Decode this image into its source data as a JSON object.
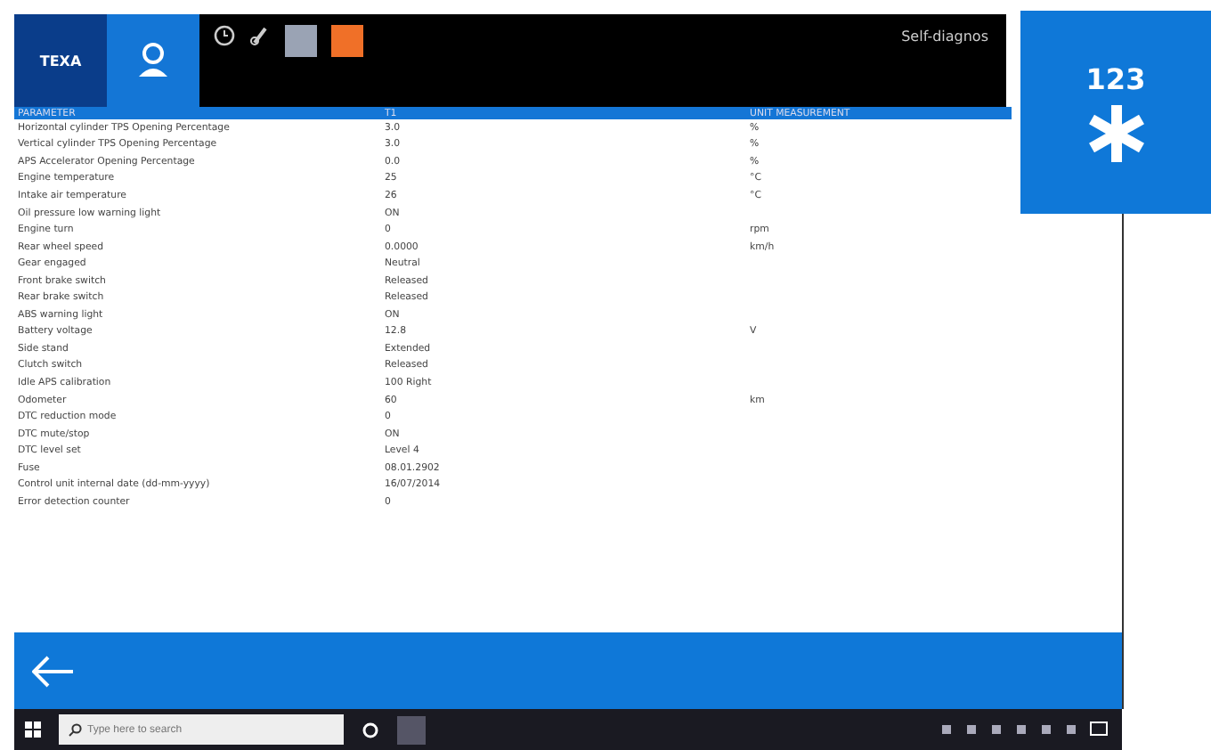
{
  "header": {
    "logo": "TEXA",
    "title": "Self-diagnos"
  },
  "table": {
    "columns": [
      "PARAMETER",
      "T1",
      "UNIT MEASUREMENT"
    ],
    "rows": [
      {
        "parameter": "Horizontal cylinder TPS Opening Percentage",
        "value": "3.0",
        "unit": "%"
      },
      {
        "parameter": "Vertical cylinder TPS Opening Percentage",
        "value": "3.0",
        "unit": "%"
      },
      {
        "parameter": "APS Accelerator Opening Percentage",
        "value": "0.0",
        "unit": "%"
      },
      {
        "parameter": "Engine temperature",
        "value": "25",
        "unit": "°C"
      },
      {
        "parameter": "Intake air temperature",
        "value": "26",
        "unit": "°C"
      },
      {
        "parameter": "Oil pressure low warning light",
        "value": "ON"
      },
      {
        "parameter": "Engine turn",
        "value": "0",
        "unit": "rpm"
      },
      {
        "parameter": "Rear wheel speed",
        "value": "0.0000",
        "unit": "km/h"
      },
      {
        "parameter": "Gear engaged",
        "value": "Neutral"
      },
      {
        "parameter": "Front brake switch",
        "value": "Released"
      },
      {
        "parameter": "Rear brake switch",
        "value": "Released"
      },
      {
        "parameter": "ABS warning light",
        "value": "ON"
      },
      {
        "parameter": "Battery voltage",
        "value": "12.8",
        "unit": "V"
      },
      {
        "parameter": "Side stand",
        "value": "Extended"
      },
      {
        "parameter": "Clutch switch",
        "value": "Released"
      },
      {
        "parameter": "Idle APS calibration",
        "value": "100 Right"
      },
      {
        "parameter": "Odometer",
        "value": "60",
        "unit": "km"
      },
      {
        "parameter": "DTC reduction mode",
        "value": "0"
      },
      {
        "parameter": "DTC mute/stop",
        "value": "ON"
      },
      {
        "parameter": "DTC level set",
        "value": "Level 4"
      },
      {
        "parameter": "Fuse",
        "value": "08.01.2902"
      },
      {
        "parameter": "Control unit internal date (dd-mm-yyyy)",
        "value": "16/07/2014"
      },
      {
        "parameter": "Error detection counter",
        "value": "0"
      }
    ]
  },
  "tile": {
    "label": "123"
  },
  "taskbar": {
    "search_placeholder": "Type here to search"
  }
}
